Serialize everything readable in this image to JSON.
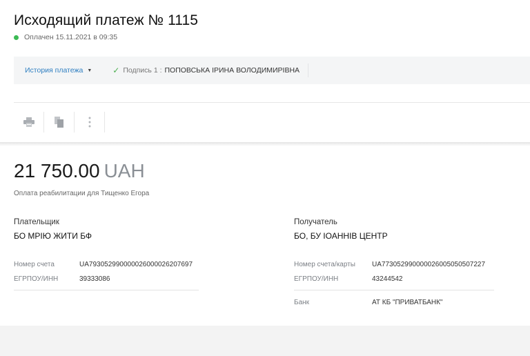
{
  "header": {
    "title": "Исходящий платеж № 1115",
    "status": "Оплачен 15.11.2021 в 09:35",
    "status_color": "#3cba54"
  },
  "infobar": {
    "history_label": "История платежа",
    "signature_label": "Подпись 1 :",
    "signer": "ПОПОВСЬКА ІРИНА ВОЛОДИМИРІВНА"
  },
  "toolbar": {
    "icons": [
      "print-icon",
      "copy-icon",
      "more-vertical-icon"
    ]
  },
  "payment": {
    "amount": "21 750.00",
    "currency": "UAH",
    "purpose": "Оплата реабилитации для Тищенко Егора"
  },
  "payer": {
    "label": "Плательщик",
    "name": "БО МРІЮ ЖИТИ БФ",
    "account_label": "Номер счета",
    "account": "UA793052990000026000026207697",
    "code_label": "ЕГРПОУ/ИНН",
    "code": "39333086"
  },
  "payee": {
    "label": "Получатель",
    "name": "БО, БУ ІОАННІВ ЦЕНТР",
    "account_label": "Номер счета/карты",
    "account": "UA773052990000026005050507227",
    "code_label": "ЕГРПОУ/ИНН",
    "code": "43244542",
    "bank_label": "Банк",
    "bank": "АТ КБ \"ПРИВАТБАНК\""
  }
}
